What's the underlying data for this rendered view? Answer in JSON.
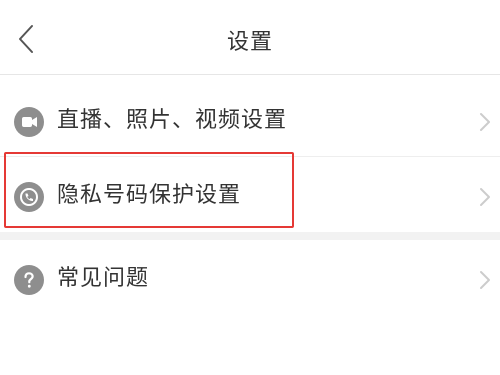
{
  "header": {
    "title": "设置",
    "back_icon": "chevron-left-icon"
  },
  "settings": {
    "items": [
      {
        "label": "直播、照片、视频设置",
        "icon": "camera-icon"
      },
      {
        "label": "隐私号码保护设置",
        "icon": "phone-shield-icon"
      },
      {
        "label": "常见问题",
        "icon": "question-icon"
      }
    ]
  },
  "colors": {
    "icon_gray": "#8e8e8e",
    "highlight_red": "#e53935",
    "section_gap": "#f2f2f2"
  }
}
